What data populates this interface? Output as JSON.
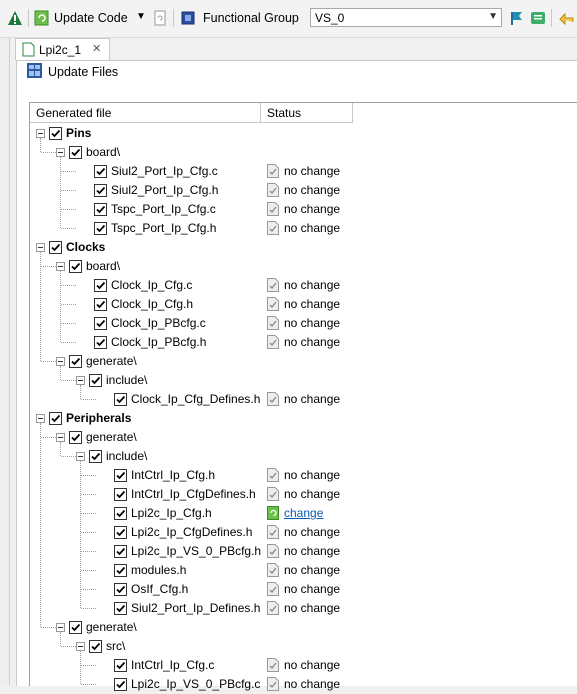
{
  "toolbar": {
    "update_code_label": "Update Code",
    "functional_group_label": "Functional Group",
    "functional_group_value": "VS_0"
  },
  "tab": {
    "label": "Lpi2c_1"
  },
  "dialog": {
    "title": "Update Files"
  },
  "table": {
    "headers": [
      "Generated file",
      "Status"
    ],
    "rows": [
      {
        "level": 0,
        "label": "Pins",
        "bold": true,
        "expandable": true,
        "status": ""
      },
      {
        "level": 1,
        "label": "board\\",
        "bold": false,
        "expandable": true,
        "status": ""
      },
      {
        "level": 2,
        "label": "Siul2_Port_Ip_Cfg.c",
        "bold": false,
        "expandable": false,
        "status": "no change"
      },
      {
        "level": 2,
        "label": "Siul2_Port_Ip_Cfg.h",
        "bold": false,
        "expandable": false,
        "status": "no change"
      },
      {
        "level": 2,
        "label": "Tspc_Port_Ip_Cfg.c",
        "bold": false,
        "expandable": false,
        "status": "no change"
      },
      {
        "level": 2,
        "label": "Tspc_Port_Ip_Cfg.h",
        "bold": false,
        "expandable": false,
        "status": "no change"
      },
      {
        "level": 0,
        "label": "Clocks",
        "bold": true,
        "expandable": true,
        "status": ""
      },
      {
        "level": 1,
        "label": "board\\",
        "bold": false,
        "expandable": true,
        "status": ""
      },
      {
        "level": 2,
        "label": "Clock_Ip_Cfg.c",
        "bold": false,
        "expandable": false,
        "status": "no change"
      },
      {
        "level": 2,
        "label": "Clock_Ip_Cfg.h",
        "bold": false,
        "expandable": false,
        "status": "no change"
      },
      {
        "level": 2,
        "label": "Clock_Ip_PBcfg.c",
        "bold": false,
        "expandable": false,
        "status": "no change"
      },
      {
        "level": 2,
        "label": "Clock_Ip_PBcfg.h",
        "bold": false,
        "expandable": false,
        "status": "no change"
      },
      {
        "level": 1,
        "label": "generate\\",
        "bold": false,
        "expandable": true,
        "status": ""
      },
      {
        "level": 2,
        "label": "include\\",
        "bold": false,
        "expandable": true,
        "status": ""
      },
      {
        "level": 3,
        "label": "Clock_Ip_Cfg_Defines.h",
        "bold": false,
        "expandable": false,
        "status": "no change"
      },
      {
        "level": 0,
        "label": "Peripherals",
        "bold": true,
        "expandable": true,
        "status": ""
      },
      {
        "level": 1,
        "label": "generate\\",
        "bold": false,
        "expandable": true,
        "status": ""
      },
      {
        "level": 2,
        "label": "include\\",
        "bold": false,
        "expandable": true,
        "status": ""
      },
      {
        "level": 3,
        "label": "IntCtrl_Ip_Cfg.h",
        "bold": false,
        "expandable": false,
        "status": "no change"
      },
      {
        "level": 3,
        "label": "IntCtrl_Ip_CfgDefines.h",
        "bold": false,
        "expandable": false,
        "status": "no change"
      },
      {
        "level": 3,
        "label": "Lpi2c_Ip_Cfg.h",
        "bold": false,
        "expandable": false,
        "status": "change"
      },
      {
        "level": 3,
        "label": "Lpi2c_Ip_CfgDefines.h",
        "bold": false,
        "expandable": false,
        "status": "no change"
      },
      {
        "level": 3,
        "label": "Lpi2c_Ip_VS_0_PBcfg.h",
        "bold": false,
        "expandable": false,
        "status": "no change"
      },
      {
        "level": 3,
        "label": "modules.h",
        "bold": false,
        "expandable": false,
        "status": "no change"
      },
      {
        "level": 3,
        "label": "OsIf_Cfg.h",
        "bold": false,
        "expandable": false,
        "status": "no change"
      },
      {
        "level": 3,
        "label": "Siul2_Port_Ip_Defines.h",
        "bold": false,
        "expandable": false,
        "status": "no change"
      },
      {
        "level": 1,
        "label": "generate\\",
        "bold": false,
        "expandable": true,
        "status": ""
      },
      {
        "level": 2,
        "label": "src\\",
        "bold": false,
        "expandable": true,
        "status": ""
      },
      {
        "level": 3,
        "label": "IntCtrl_Ip_Cfg.c",
        "bold": false,
        "expandable": false,
        "status": "no change"
      },
      {
        "level": 3,
        "label": "Lpi2c_Ip_VS_0_PBcfg.c",
        "bold": false,
        "expandable": false,
        "status": "no change"
      }
    ]
  },
  "colors": {
    "change_icon": "#6cc04a",
    "link": "#0b5bb5",
    "warning": "#1a7a3a"
  }
}
